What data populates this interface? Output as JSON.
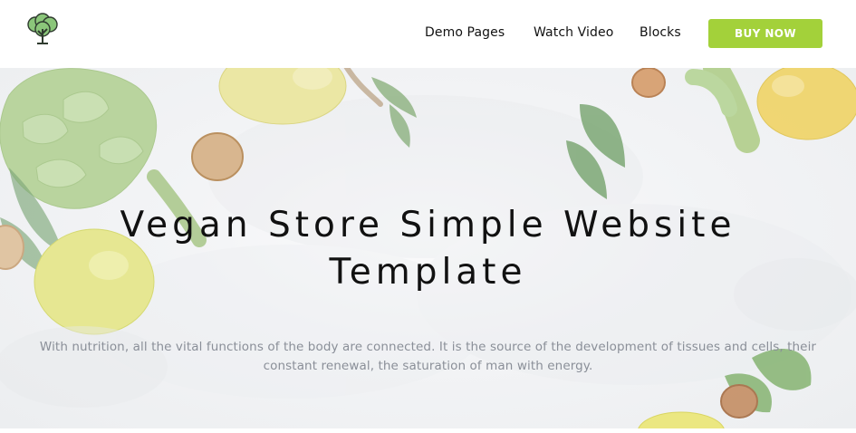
{
  "header": {
    "logo_icon": "tree-icon",
    "nav": [
      {
        "label": "Demo Pages"
      },
      {
        "label": "Watch Video"
      },
      {
        "label": "Blocks"
      }
    ],
    "cta_label": "BUY NOW"
  },
  "hero": {
    "title_line1": "Vegan Store Simple Website",
    "title_line2": "Template",
    "text_line1": "With nutrition, all the vital functions of the body are connected. It is the source of the development of tissues and cells, their",
    "text_line2": "constant renewal, the saturation of man with energy."
  },
  "colors": {
    "accent": "#a3d13a",
    "text": "#111111",
    "muted": "#8a8f98"
  }
}
